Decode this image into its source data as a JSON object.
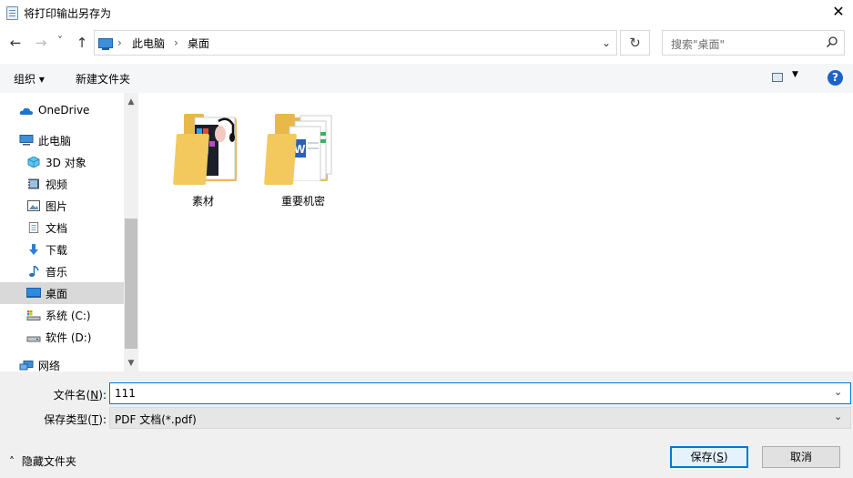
{
  "window": {
    "title": "将打印输出另存为",
    "close_glyph": "✕"
  },
  "nav": {
    "back": "←",
    "forward": "→",
    "recent": "˅",
    "up": "↑"
  },
  "address": {
    "crumbs": [
      "此电脑",
      "桌面"
    ],
    "sep": "›",
    "dropdown": "⌄",
    "refresh": "↻"
  },
  "search": {
    "placeholder": "搜索\"桌面\""
  },
  "toolbar": {
    "organize": "组织 ▾",
    "new_folder": "新建文件夹",
    "view_dd": "▼",
    "help": "?"
  },
  "sidebar": {
    "items": [
      {
        "label": "OneDrive",
        "icon": "cloud-icon"
      },
      {
        "label": "此电脑",
        "icon": "computer-icon"
      },
      {
        "label": "3D 对象",
        "icon": "cube-icon"
      },
      {
        "label": "视频",
        "icon": "video-icon"
      },
      {
        "label": "图片",
        "icon": "picture-icon"
      },
      {
        "label": "文档",
        "icon": "document-icon"
      },
      {
        "label": "下载",
        "icon": "download-icon"
      },
      {
        "label": "音乐",
        "icon": "music-icon"
      },
      {
        "label": "桌面",
        "icon": "desktop-icon",
        "selected": true
      },
      {
        "label": "系统 (C:)",
        "icon": "drive-icon"
      },
      {
        "label": "软件 (D:)",
        "icon": "drive-icon"
      },
      {
        "label": "网络",
        "icon": "network-icon"
      }
    ],
    "scroll_up": "▲",
    "scroll_down": "▼"
  },
  "content": {
    "folders": [
      {
        "label": "素材"
      },
      {
        "label": "重要机密"
      }
    ]
  },
  "form": {
    "filename_label": "文件名(",
    "filename_key": "N",
    "filename_tail": "):",
    "filename_value": "111",
    "filetype_label": "保存类型(",
    "filetype_key": "T",
    "filetype_tail": "):",
    "filetype_value": "PDF 文档(*.pdf)",
    "dropdown": "⌄"
  },
  "footer": {
    "hide_folders": "隐藏文件夹",
    "hide_glyph": "˄",
    "save_label": "保存(",
    "save_key": "S",
    "save_tail": ")",
    "cancel_label": "取消"
  },
  "colors": {
    "accent": "#0078d7",
    "selected": "#d9d9d9",
    "folder": "#f6cf66"
  }
}
